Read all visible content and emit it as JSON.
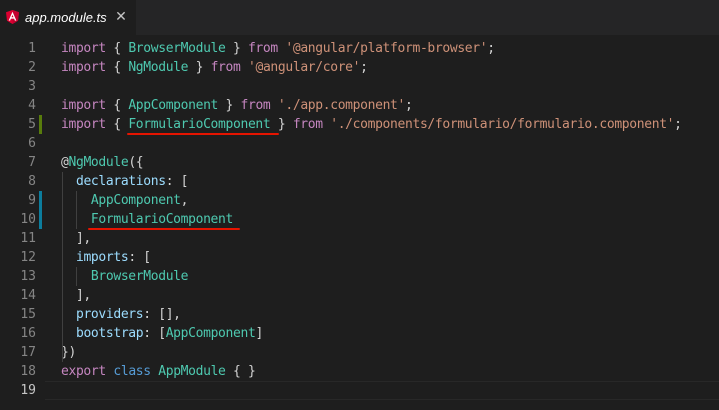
{
  "tab": {
    "title": "app.module.ts",
    "close_glyph": "✕",
    "icon": "angular-icon",
    "accent": "#dd0031"
  },
  "lines": [
    {
      "num": "1",
      "tokens": [
        [
          "kw2",
          "import"
        ],
        [
          "pn",
          " { "
        ],
        [
          "ty",
          "BrowserModule"
        ],
        [
          "pn",
          " } "
        ],
        [
          "kw2",
          "from"
        ],
        [
          "pn",
          " "
        ],
        [
          "str",
          "'@angular/platform-browser'"
        ],
        [
          "pn",
          ";"
        ]
      ]
    },
    {
      "num": "2",
      "tokens": [
        [
          "kw2",
          "import"
        ],
        [
          "pn",
          " { "
        ],
        [
          "ty",
          "NgModule"
        ],
        [
          "pn",
          " } "
        ],
        [
          "kw2",
          "from"
        ],
        [
          "pn",
          " "
        ],
        [
          "str",
          "'@angular/core'"
        ],
        [
          "pn",
          ";"
        ]
      ]
    },
    {
      "num": "3",
      "tokens": []
    },
    {
      "num": "4",
      "tokens": [
        [
          "kw2",
          "import"
        ],
        [
          "pn",
          " { "
        ],
        [
          "ty",
          "AppComponent"
        ],
        [
          "pn",
          " } "
        ],
        [
          "kw2",
          "from"
        ],
        [
          "pn",
          " "
        ],
        [
          "str",
          "'./app.component'"
        ],
        [
          "pn",
          ";"
        ]
      ]
    },
    {
      "num": "5",
      "tokens": [
        [
          "kw2",
          "import"
        ],
        [
          "pn",
          " { "
        ],
        [
          "ty",
          "FormularioComponent"
        ],
        [
          "pn",
          " } "
        ],
        [
          "kw2",
          "from"
        ],
        [
          "pn",
          " "
        ],
        [
          "str",
          "'./components/formulario/formulario.component'"
        ],
        [
          "pn",
          ";"
        ]
      ]
    },
    {
      "num": "6",
      "tokens": []
    },
    {
      "num": "7",
      "tokens": [
        [
          "pn",
          "@"
        ],
        [
          "ty",
          "NgModule"
        ],
        [
          "pn",
          "({"
        ]
      ]
    },
    {
      "num": "8",
      "tokens": [
        [
          "pn",
          "  "
        ],
        [
          "vr",
          "declarations"
        ],
        [
          "pn",
          ": ["
        ]
      ]
    },
    {
      "num": "9",
      "tokens": [
        [
          "pn",
          "    "
        ],
        [
          "ty",
          "AppComponent"
        ],
        [
          "pn",
          ","
        ]
      ]
    },
    {
      "num": "10",
      "tokens": [
        [
          "pn",
          "    "
        ],
        [
          "ty",
          "FormularioComponent"
        ]
      ]
    },
    {
      "num": "11",
      "tokens": [
        [
          "pn",
          "  ],"
        ]
      ]
    },
    {
      "num": "12",
      "tokens": [
        [
          "pn",
          "  "
        ],
        [
          "vr",
          "imports"
        ],
        [
          "pn",
          ": ["
        ]
      ]
    },
    {
      "num": "13",
      "tokens": [
        [
          "pn",
          "    "
        ],
        [
          "ty",
          "BrowserModule"
        ]
      ]
    },
    {
      "num": "14",
      "tokens": [
        [
          "pn",
          "  ],"
        ]
      ]
    },
    {
      "num": "15",
      "tokens": [
        [
          "pn",
          "  "
        ],
        [
          "vr",
          "providers"
        ],
        [
          "pn",
          ": [],"
        ]
      ]
    },
    {
      "num": "16",
      "tokens": [
        [
          "pn",
          "  "
        ],
        [
          "vr",
          "bootstrap"
        ],
        [
          "pn",
          ": ["
        ],
        [
          "ty",
          "AppComponent"
        ],
        [
          "pn",
          "]"
        ]
      ]
    },
    {
      "num": "17",
      "tokens": [
        [
          "pn",
          "})"
        ]
      ]
    },
    {
      "num": "18",
      "tokens": [
        [
          "kw2",
          "export"
        ],
        [
          "pn",
          " "
        ],
        [
          "kw",
          "class"
        ],
        [
          "pn",
          " "
        ],
        [
          "ty",
          "AppModule"
        ],
        [
          "pn",
          " { }"
        ]
      ]
    },
    {
      "num": "19",
      "tokens": []
    }
  ],
  "active_line": "19",
  "gutter_colors": {
    "added": "#587c0c",
    "modified": "#0c7d9d"
  },
  "error_underline_color": "#e51400"
}
